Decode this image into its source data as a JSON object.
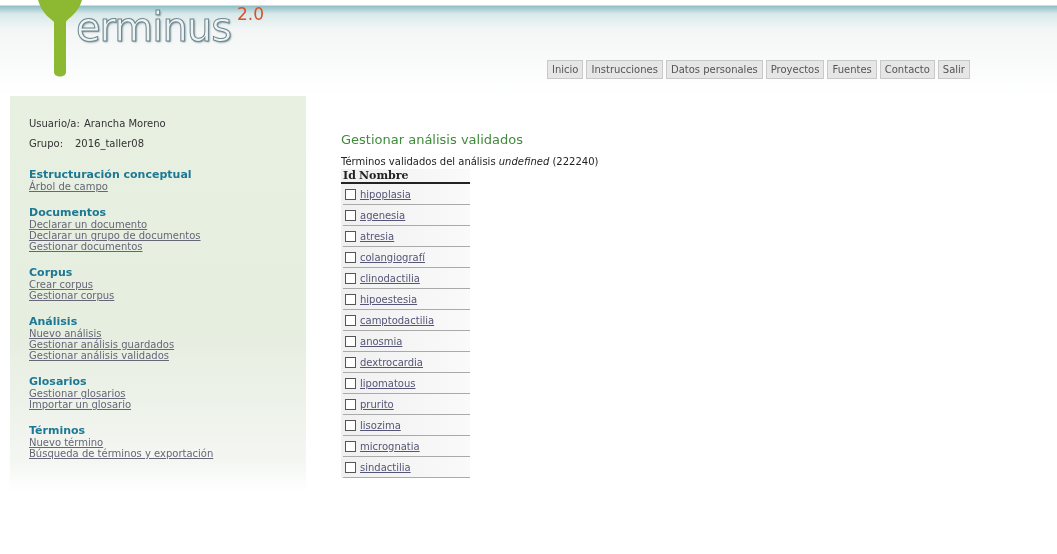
{
  "logo": {
    "text": "erminus",
    "version": "2.0"
  },
  "nav": [
    "Inicio",
    "Instrucciones",
    "Datos personales",
    "Proyectos",
    "Fuentes",
    "Contacto",
    "Salir"
  ],
  "user": {
    "label": "Usuario/a:",
    "name": "Arancha Moreno",
    "group_label": "Grupo:",
    "group": "2016_taller08"
  },
  "sections": [
    {
      "title": "Estructuración conceptual",
      "links": [
        "Árbol de campo"
      ]
    },
    {
      "title": "Documentos",
      "links": [
        "Declarar un documento",
        "Declarar un grupo de documentos",
        "Gestionar documentos"
      ]
    },
    {
      "title": "Corpus",
      "links": [
        "Crear corpus",
        "Gestionar corpus"
      ]
    },
    {
      "title": "Análisis",
      "links": [
        "Nuevo análisis",
        "Gestionar análisis guardados",
        "Gestionar análisis validados"
      ]
    },
    {
      "title": "Glosarios",
      "links": [
        "Gestionar glosarios",
        "Importar un glosario"
      ]
    },
    {
      "title": "Términos",
      "links": [
        "Nuevo término",
        "Búsqueda de términos y exportación"
      ]
    }
  ],
  "page_title": "Gestionar análisis validados",
  "subtitle": "Términos validados del análisis *undefined* (222240)",
  "table": {
    "columns": [
      "Id",
      "Nombre"
    ],
    "rows": [
      {
        "name": "hipoplasia",
        "checked": false
      },
      {
        "name": "agenesia",
        "checked": false
      },
      {
        "name": "atresia",
        "checked": false
      },
      {
        "name": "colangiografí",
        "checked": false
      },
      {
        "name": "clinodactilia",
        "checked": false
      },
      {
        "name": "hipoestesia",
        "checked": false
      },
      {
        "name": "camptodactilia",
        "checked": false
      },
      {
        "name": "anosmia",
        "checked": false
      },
      {
        "name": "dextrocardia",
        "checked": false
      },
      {
        "name": "lipomatous",
        "checked": false
      },
      {
        "name": "prurito",
        "checked": false
      },
      {
        "name": "lisozima",
        "checked": false
      },
      {
        "name": "micrognatia",
        "checked": false
      },
      {
        "name": "sindactilia",
        "checked": false
      }
    ]
  }
}
